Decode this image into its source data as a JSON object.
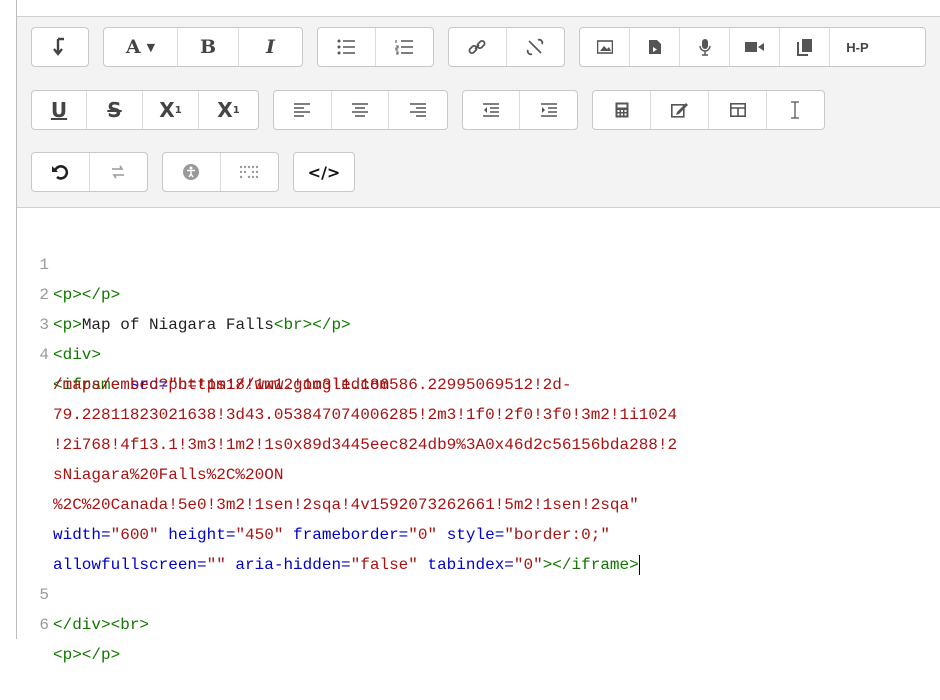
{
  "toolbar": {
    "row1": [
      {
        "name": "paragraph-format-icon",
        "glyph": "↴"
      },
      {
        "name": "font-color-icon",
        "glyph": "A ▾"
      },
      {
        "name": "bold-icon",
        "glyph": "B"
      },
      {
        "name": "italic-icon",
        "glyph": "I"
      },
      {
        "name": "bullet-list-icon",
        "glyph": "☰"
      },
      {
        "name": "numbered-list-icon",
        "glyph": "☰"
      },
      {
        "name": "link-icon",
        "glyph": "🔗"
      },
      {
        "name": "unlink-icon",
        "glyph": "⛓"
      },
      {
        "name": "image-icon",
        "glyph": "▣"
      },
      {
        "name": "media-icon",
        "glyph": "▤"
      },
      {
        "name": "microphone-icon",
        "glyph": "🎙"
      },
      {
        "name": "video-icon",
        "glyph": "■"
      },
      {
        "name": "copy-icon",
        "glyph": "❐"
      },
      {
        "name": "h5p-icon",
        "glyph": "H-P"
      }
    ],
    "row2": [
      {
        "name": "underline-icon",
        "glyph": "U"
      },
      {
        "name": "strikethrough-icon",
        "glyph": "S"
      },
      {
        "name": "subscript-icon",
        "glyph": "X₁"
      },
      {
        "name": "superscript-icon",
        "glyph": "X¹"
      },
      {
        "name": "align-left-icon",
        "glyph": "≡"
      },
      {
        "name": "align-center-icon",
        "glyph": "≡"
      },
      {
        "name": "align-right-icon",
        "glyph": "≡"
      },
      {
        "name": "outdent-icon",
        "glyph": "⇤"
      },
      {
        "name": "indent-icon",
        "glyph": "⇥"
      },
      {
        "name": "calculator-icon",
        "glyph": "▦"
      },
      {
        "name": "edit-icon",
        "glyph": "✎"
      },
      {
        "name": "table-icon",
        "glyph": "⊞"
      },
      {
        "name": "text-cursor-icon",
        "glyph": "I"
      }
    ],
    "row3": [
      {
        "name": "undo-icon",
        "glyph": "↶"
      },
      {
        "name": "redo-icon",
        "glyph": "⟲"
      },
      {
        "name": "accessibility-icon",
        "glyph": "●"
      },
      {
        "name": "braille-icon",
        "glyph": "⠿"
      },
      {
        "name": "html-source-icon",
        "glyph": "</>"
      }
    ]
  },
  "code": {
    "line_numbers": [
      "1",
      "2",
      "3",
      "4",
      "5",
      "6"
    ],
    "l1": "<p></p>",
    "l2_open": "<p>",
    "l2_text": "Map of Niagara Falls",
    "l2_close": "<br></p>",
    "l3": "<div>",
    "l4_tag": "<iframe",
    "l4_attr": " src=",
    "l4_str": "\"https://www.google.com",
    "l4_cont1": "/maps/embed?pb=!1m18!1m12!1m3!1d186586.22995069512!2d-",
    "l4_cont2": "79.22811823021638!3d43.053847074006285!2m3!1f0!2f0!3f0!3m2!1i1024",
    "l4_cont3": "!2i768!4f13.1!3m3!1m2!1s0x89d3445eec824db9%3A0x46d2c56156bda288!2",
    "l4_cont4": "sNiagara%20Falls%2C%20ON",
    "l4_cont5": "%2C%20Canada!5e0!3m2!1sen!2sqa!4v1592073262661!5m2!1sen!2sqa\"",
    "l4_w_attr": "width=",
    "l4_w_val": "\"600\"",
    "l4_h_attr": " height=",
    "l4_h_val": "\"450\"",
    "l4_fb_attr": " frameborder=",
    "l4_fb_val": "\"0\"",
    "l4_st_attr": " style=",
    "l4_st_val": "\"border:0;\"",
    "l4_af_attr": "allowfullscreen=",
    "l4_af_val": "\"\"",
    "l4_ah_attr": " aria-hidden=",
    "l4_ah_val": "\"false\"",
    "l4_ti_attr": " tabindex=",
    "l4_ti_val": "\"0\"",
    "l4_end": "></iframe>",
    "l5": "</div><br>",
    "l6": "<p></p>"
  },
  "colors": {
    "tag": "#117700",
    "attr": "#0000cc",
    "string": "#aa1111"
  }
}
